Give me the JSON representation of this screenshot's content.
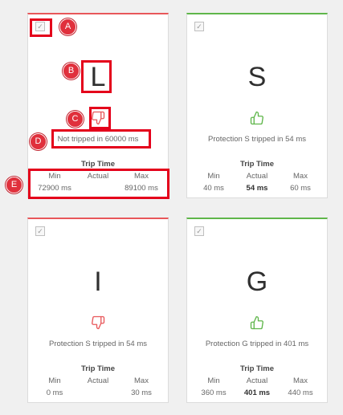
{
  "colors": {
    "fail_accent": "#e8575a",
    "pass_accent": "#5fb64a",
    "annotation_red": "#e4001b"
  },
  "cards": [
    {
      "letter": "L",
      "status": "fail",
      "icon": "thumbs-down-icon",
      "checkbox_checked": true,
      "result": "Not tripped in 60000 ms",
      "trip_title": "Trip Time",
      "headers": {
        "min": "Min",
        "actual": "Actual",
        "max": "Max"
      },
      "values": {
        "min": "72900 ms",
        "actual": "",
        "max": "89100 ms"
      }
    },
    {
      "letter": "S",
      "status": "pass",
      "icon": "thumbs-up-icon",
      "checkbox_checked": true,
      "result": "Protection S tripped in 54 ms",
      "trip_title": "Trip Time",
      "headers": {
        "min": "Min",
        "actual": "Actual",
        "max": "Max"
      },
      "values": {
        "min": "40 ms",
        "actual": "54 ms",
        "max": "60 ms"
      }
    },
    {
      "letter": "I",
      "status": "fail",
      "icon": "thumbs-down-icon",
      "checkbox_checked": true,
      "result": "Protection S tripped in 54 ms",
      "trip_title": "Trip Time",
      "headers": {
        "min": "Min",
        "actual": "Actual",
        "max": "Max"
      },
      "values": {
        "min": "0 ms",
        "actual": "",
        "max": "30 ms"
      }
    },
    {
      "letter": "G",
      "status": "pass",
      "icon": "thumbs-up-icon",
      "checkbox_checked": true,
      "result": "Protection G tripped in 401 ms",
      "trip_title": "Trip Time",
      "headers": {
        "min": "Min",
        "actual": "Actual",
        "max": "Max"
      },
      "values": {
        "min": "360 ms",
        "actual": "401 ms",
        "max": "440 ms"
      }
    }
  ],
  "annotations": [
    "A",
    "B",
    "C",
    "D",
    "E"
  ]
}
